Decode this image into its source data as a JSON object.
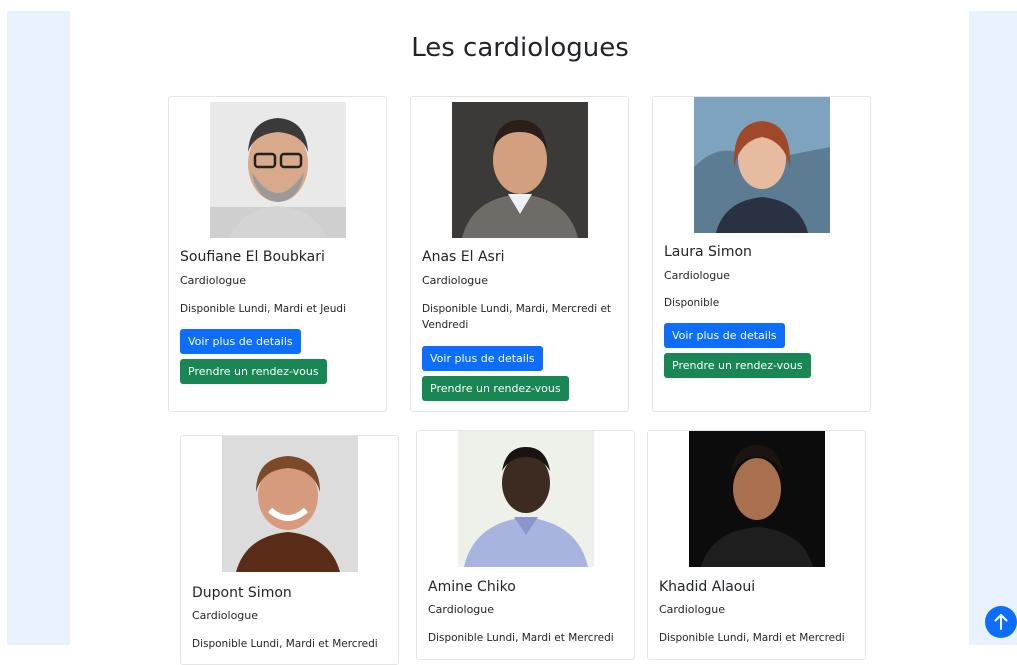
{
  "page": {
    "title": "Les cardiologues"
  },
  "doctors": [
    {
      "name": "Soufiane El Boubkari",
      "specialty": "Cardiologue",
      "availability": "Disponible Lundi, Mardi et Jeudi",
      "details_label": "Voir plus de details",
      "appointment_label": "Prendre un rendez-vous"
    },
    {
      "name": "Anas El Asri",
      "specialty": "Cardiologue",
      "availability": "Disponible Lundi, Mardi, Mercredi et Vendredi",
      "details_label": "Voir plus de details",
      "appointment_label": "Prendre un rendez-vous"
    },
    {
      "name": "Laura Simon",
      "specialty": "Cardiologue",
      "availability": "Disponible",
      "details_label": "Voir plus de details",
      "appointment_label": "Prendre un rendez-vous"
    },
    {
      "name": "Dupont Simon",
      "specialty": "Cardiologue",
      "availability": "Disponible Lundi, Mardi et Mercredi"
    },
    {
      "name": "Amine Chiko",
      "specialty": "Cardiologue",
      "availability": "Disponible Lundi, Mardi et Mercredi"
    },
    {
      "name": "Khadid Alaoui",
      "specialty": "Cardiologue",
      "availability": "Disponible Lundi, Mardi et Mercredi"
    }
  ],
  "scroll_top_icon": "arrow-up-icon",
  "colors": {
    "primary": "#0d6efd",
    "success": "#198754",
    "side_panel": "#e8f2ff"
  }
}
